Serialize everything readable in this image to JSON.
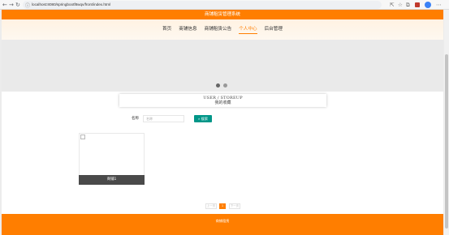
{
  "browser": {
    "url": "localhost:8080/springbootf8wqv/front/index.html",
    "back_icon": "←",
    "forward_icon": "→",
    "reload_icon": "↻",
    "info_icon": "ⓘ",
    "tools": [
      "⇱",
      "☆",
      "⧉",
      "⋯"
    ]
  },
  "site": {
    "title": "商铺租赁管理系统",
    "nav": [
      {
        "label": "首页",
        "active": false
      },
      {
        "label": "商铺信息",
        "active": false
      },
      {
        "label": "商铺租赁公告",
        "active": false
      },
      {
        "label": "个人中心",
        "active": true
      },
      {
        "label": "后台管理",
        "active": false
      }
    ]
  },
  "section": {
    "title_en": "USER / STOREUP",
    "title_cn": "我的收藏"
  },
  "search": {
    "label": "名称",
    "placeholder": "名称",
    "button_label": "搜索",
    "button_icon": "search-icon"
  },
  "favorites": [
    {
      "name": "商铺1"
    }
  ],
  "pagination": {
    "prev_label": "上一页",
    "current": "1",
    "next_label": "下一页"
  },
  "footer": {
    "text": "商铺租赁"
  },
  "colors": {
    "brand": "#ff7e00",
    "search_button": "#009688"
  }
}
